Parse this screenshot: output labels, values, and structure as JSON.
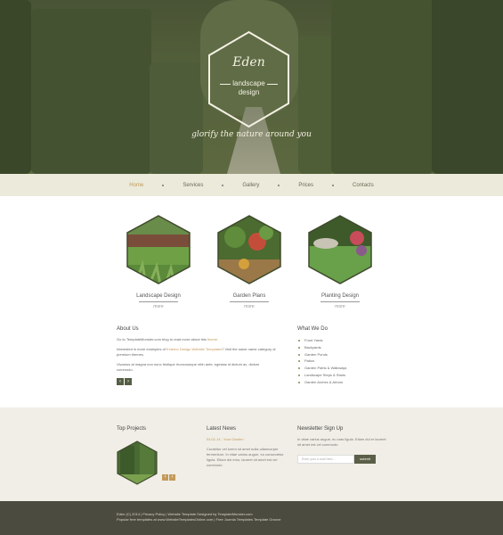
{
  "brand": {
    "title": "Eden",
    "subtitle_line1": "landscape",
    "subtitle_line2": "design",
    "tagline": "glorify the nature around you"
  },
  "nav": {
    "items": [
      "Home",
      "Services",
      "Gallery",
      "Prices",
      "Contacts"
    ],
    "active": "Home"
  },
  "services": [
    {
      "title": "Landscape Design",
      "more": "more"
    },
    {
      "title": "Garden Plans",
      "more": "more"
    },
    {
      "title": "Planting Design",
      "more": "more"
    }
  ],
  "about": {
    "heading": "About Us",
    "p1_a": "Go to TemplateMonster.com blog to read more about this ",
    "p1_link": "theme",
    "p1_b": ".",
    "p2_a": "Interested in more examples of ",
    "p2_link": "Exterior Design Website Templates",
    "p2_b": "? Visit the same name category of premium themes.",
    "p3": "Vivamus at magna non nunc tristique rhoncuseque nibh ante, egestas id dictum ac, dictum commodo."
  },
  "whatwedo": {
    "heading": "What We Do",
    "items": [
      "Front Yards",
      "Backyards",
      "Garden Ponds",
      "Patios",
      "Garden Paths & Walkways",
      "Landscape Steps & Stairs",
      "Garden Arches & Arbors"
    ]
  },
  "projects": {
    "heading": "Top Projects"
  },
  "news": {
    "heading": "Latest News",
    "date": "04.01.14 - Your Garden",
    "text": "Curabitur vel lorem sit amet nulla ullamcorper fermentum. In vitae varius augue, eu consectetur ligula. Etiam dui eros, laoreet sit amet est vel commodo"
  },
  "newsletter": {
    "heading": "Newsletter Sign Up",
    "text": "In vitae varius augue, eu cras ligula. Etiam dui er laoreet sit amet est vel commodo",
    "placeholder": "Enter your e-mail here...",
    "button": "submit"
  },
  "footer": {
    "line1": "Eden (C) 2014  |  Privacy Policy  |  Website Template Designed by TemplateMonster.com",
    "line2": "Popular free templates at www.WebsiteTemplatesOnline.com  |  Free Joomla Templates Template Groove"
  },
  "colors": {
    "accent": "#c39a5a",
    "hedge_dark": "#3f4b2d",
    "nav_bg": "#ebeadb",
    "footer_dark": "#4c4b3f",
    "button": "#5a6048"
  },
  "icons": {
    "prev": "chevron-left-icon",
    "next": "chevron-right-icon"
  }
}
